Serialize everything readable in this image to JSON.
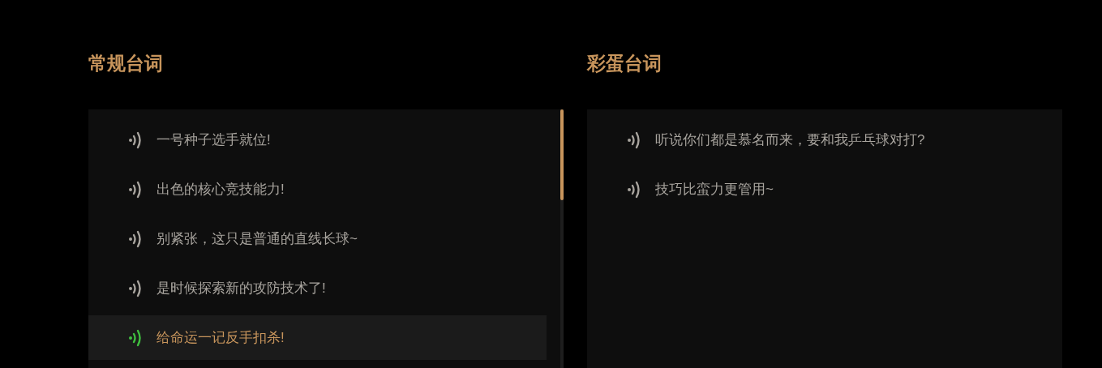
{
  "sections": [
    {
      "title": "常规台词",
      "lines": [
        {
          "text": "一号种子选手就位!",
          "selected": false
        },
        {
          "text": "出色的核心竞技能力!",
          "selected": false
        },
        {
          "text": "别紧张，这只是普通的直线长球~",
          "selected": false
        },
        {
          "text": "是时候探索新的攻防技术了!",
          "selected": false
        },
        {
          "text": "给命运一记反手扣杀!",
          "selected": true
        }
      ]
    },
    {
      "title": "彩蛋台词",
      "lines": [
        {
          "text": "听说你们都是慕名而来，要和我乒乓球对打?",
          "selected": false
        },
        {
          "text": "技巧比蛮力更管用~",
          "selected": false
        }
      ]
    }
  ]
}
